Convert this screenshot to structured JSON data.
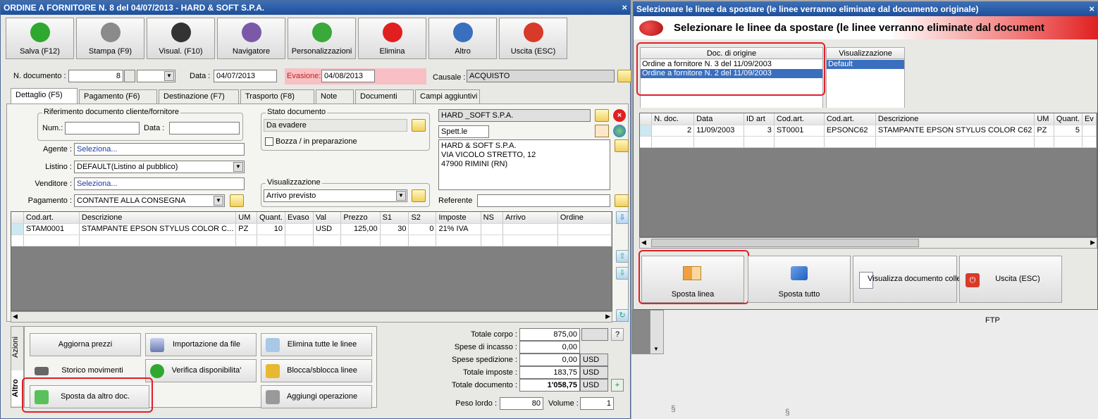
{
  "left": {
    "title": "ORDINE A FORNITORE N. 8 del 04/07/2013 - HARD & SOFT S.P.A.",
    "close": "×",
    "toolbar": [
      {
        "label": "Salva (F12)",
        "icon": "check-icon",
        "color": "#2fa82f"
      },
      {
        "label": "Stampa (F9)",
        "icon": "printer-icon",
        "color": "#8a8a8a"
      },
      {
        "label": "Visual. (F10)",
        "icon": "magic-wand-icon",
        "color": "#333333"
      },
      {
        "label": "Navigatore",
        "icon": "compass-icon",
        "color": "#7a5aa8"
      },
      {
        "label": "Personalizzazioni",
        "icon": "puzzle-icon",
        "color": "#3aa83a"
      },
      {
        "label": "Elimina",
        "icon": "delete-icon",
        "color": "#e02020"
      },
      {
        "label": "Altro",
        "icon": "magnifier-icon",
        "color": "#3a6fbf"
      },
      {
        "label": "Uscita (ESC)",
        "icon": "power-icon",
        "color": "#d83a2a"
      }
    ],
    "header": {
      "ndoc_label": "N. documento :",
      "ndoc_value": "8",
      "data_label": "Data :",
      "data_value": "04/07/2013",
      "evasione_label": "Evasione:",
      "evasione_value": "04/08/2013",
      "causale_label": "Causale :",
      "causale_value": "ACQUISTO"
    },
    "tabs": [
      "Dettaglio (F5)",
      "Pagamento (F6)",
      "Destinazione (F7)",
      "Trasporto (F8)",
      "Note",
      "Documenti",
      "Campi aggiuntivi"
    ],
    "rif": {
      "title": "Riferimento documento cliente/fornitore",
      "num_label": "Num.:",
      "data_label": "Data :"
    },
    "stato": {
      "title": "Stato documento",
      "value": "Da evadere",
      "bozza": "Bozza / in preparazione"
    },
    "fields": {
      "agente_label": "Agente :",
      "agente_value": "Seleziona...",
      "listino_label": "Listino :",
      "listino_value": "DEFAULT(Listino al pubblico)",
      "venditore_label": "Venditore :",
      "venditore_value": "Seleziona...",
      "pagamento_label": "Pagamento :",
      "pagamento_value": "CONTANTE ALLA CONSEGNA"
    },
    "visual": {
      "title": "Visualizzazione",
      "value": "Arrivo previsto"
    },
    "supplier": {
      "name": "HARD _SOFT S.P.A.",
      "salutation": "Spett.le",
      "address": [
        "HARD & SOFT S.P.A.",
        "VIA VICOLO STRETTO, 12",
        "47900 RIMINI (RN)"
      ],
      "referente_label": "Referente"
    },
    "grid": {
      "columns": [
        "Cod.art.",
        "Descrizione",
        "UM",
        "Quant.",
        "Evaso",
        "Val",
        "Prezzo",
        "S1",
        "S2",
        "Imposte",
        "NS",
        "Arrivo",
        "Ordine"
      ],
      "rows": [
        [
          "STAM0001",
          "STAMPANTE EPSON STYLUS COLOR C...",
          "PZ",
          "10",
          "",
          "USD",
          "125,00",
          "30",
          "0",
          "21% IVA",
          "",
          "",
          ""
        ]
      ]
    },
    "side_tabs": {
      "azioni": "Azioni",
      "altro": "Altro"
    },
    "actions": {
      "aggiorna": "Aggiorna prezzi",
      "importazione": "Importazione da file",
      "elimina_tutte": "Elimina tutte le linee",
      "storico": "Storico movimenti",
      "verifica": "Verifica disponibilita'",
      "blocca": "Blocca/sblocca linee",
      "sposta": "Sposta da altro doc.",
      "aggiungi": "Aggiungi operazione"
    },
    "totals": {
      "corpo_label": "Totale corpo :",
      "corpo": "875,00",
      "incasso_label": "Spese di incasso :",
      "incasso": "0,00",
      "spedizione_label": "Spese spedizione :",
      "spedizione": "0,00",
      "imposte_label": "Totale imposte :",
      "imposte": "183,75",
      "documento_label": "Totale documento :",
      "documento": "1'058,75",
      "currency": "USD",
      "help": "?",
      "peso_label": "Peso lordo :",
      "peso": "80",
      "volume_label": "Volume :",
      "volume": "1"
    }
  },
  "right": {
    "title": "Selezionare le linee da spostare (le linee verranno eliminate dal documento originale)",
    "banner": "Selezionare le linee da spostare (le linee verranno eliminate dal document",
    "close": "×",
    "doc_origine": {
      "title": "Doc. di origine",
      "items": [
        "Ordine a fornitore N. 3 del 11/09/2003",
        "Ordine a fornitore N. 2 del 11/09/2003"
      ]
    },
    "visual": {
      "title": "Visualizzazione",
      "items": [
        "Default"
      ]
    },
    "grid": {
      "columns": [
        "N. doc.",
        "Data",
        "ID art",
        "Cod.art.",
        "Cod.art.",
        "Descrizione",
        "UM",
        "Quant.",
        "Ev"
      ],
      "rows": [
        [
          "2",
          "11/09/2003",
          "3",
          "ST0001",
          "EPSONC62",
          "STAMPANTE EPSON STYLUS COLOR C62",
          "PZ",
          "5",
          ""
        ]
      ]
    },
    "buttons": {
      "sposta_linea": "Sposta linea",
      "sposta_tutto": "Sposta tutto",
      "visualizza": "Visualizza documento colle",
      "uscita": "Uscita (ESC)"
    },
    "bg_text": "FTP"
  }
}
